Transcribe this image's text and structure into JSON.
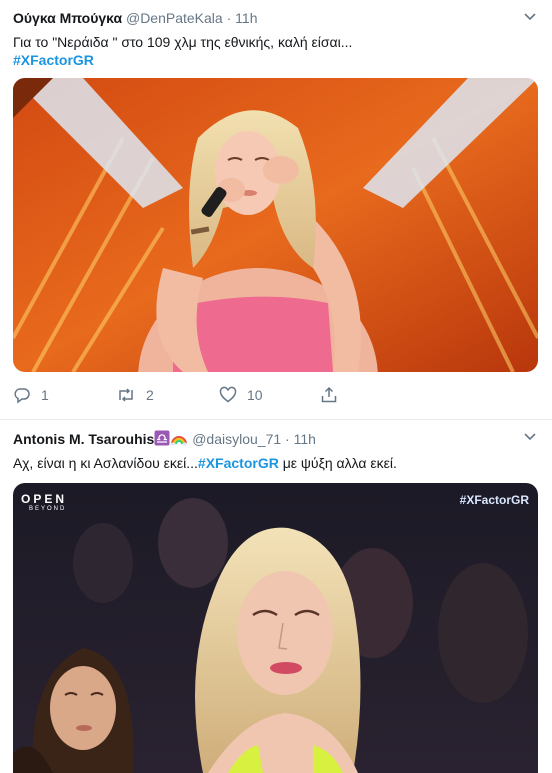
{
  "tweet1": {
    "name": "Ούγκα Μπούγκα",
    "handle": "@DenPateKala",
    "separator": "·",
    "time": "11h",
    "text": "Για το \"Νεράιδα \" στο 109 χλμ της εθνικής, καλή είσαι...",
    "hashtag": "#XFactorGR",
    "image_description": "singer-on-stage-photo",
    "actions": {
      "reply_count": "1",
      "retweet_count": "2",
      "like_count": "10"
    }
  },
  "tweet2": {
    "name": "Antonis M. Tsarouhis",
    "handle": "@daisylou_71",
    "separator": "·",
    "time": "11h",
    "text_before": "Αχ, είναι η κι Ασλανίδου εκεί...",
    "hashtag": "#XFactorGR",
    "text_after": " με ψύξη αλλα εκεί.",
    "video_logo": "OPEN",
    "video_logo_sub": "BEYOND",
    "video_tag": "#XFactorGR"
  },
  "colors": {
    "link": "#1b95e0",
    "secondary": "#657786",
    "divider": "#e6ecf0"
  },
  "icons": [
    "chevron-down-icon",
    "reply-icon",
    "retweet-icon",
    "like-icon",
    "share-icon",
    "libra-emoji-icon",
    "rainbow-emoji-icon"
  ]
}
